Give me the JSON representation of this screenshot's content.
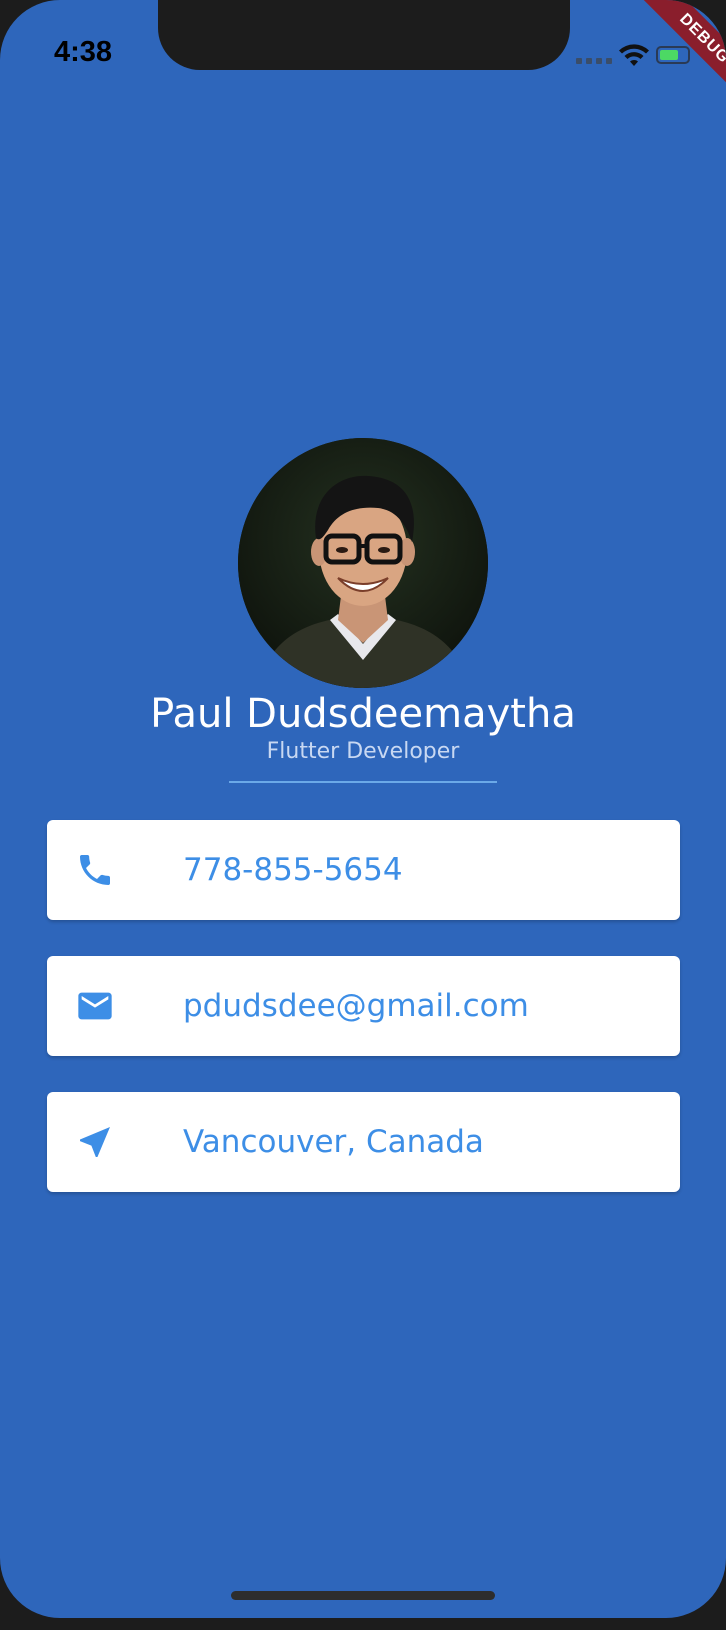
{
  "status_bar": {
    "time": "4:38",
    "debug_label": "DEBUG"
  },
  "profile": {
    "name": "Paul Dudsdeemaytha",
    "title": "Flutter Developer"
  },
  "contacts": [
    {
      "icon": "phone-icon",
      "value": "778-855-5654"
    },
    {
      "icon": "mail-icon",
      "value": "pdudsdee@gmail.com"
    },
    {
      "icon": "location-arrow-icon",
      "value": "Vancouver, Canada"
    }
  ],
  "colors": {
    "background": "#2e66bb",
    "accent": "#3d8ee6",
    "card": "#ffffff",
    "divider": "#6ba9e8",
    "debug_ribbon": "#8a1e2c"
  }
}
